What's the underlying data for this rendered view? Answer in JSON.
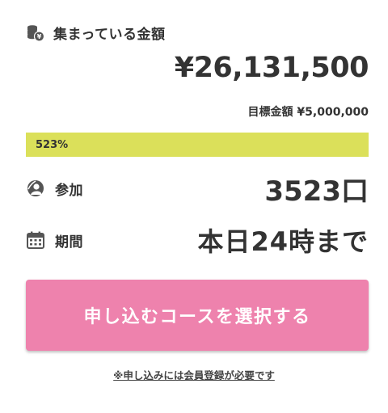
{
  "raised": {
    "label": "集まっている金額",
    "amount": "¥26,131,500",
    "goal_text": "目標金額 ¥5,000,000",
    "icon": "coin-stack-icon"
  },
  "progress": {
    "percent_label": "523%",
    "fill_fraction": 1.0,
    "fill_color": "#dbe05a"
  },
  "participants": {
    "label": "参加",
    "value": "3523口",
    "icon": "person-circle-icon"
  },
  "period": {
    "label": "期間",
    "value": "本日24時まで",
    "icon": "calendar-icon"
  },
  "cta": {
    "label": "申し込むコースを選択する",
    "color": "#ee82ad"
  },
  "note": {
    "text": "※申し込みには会員登録が必要です"
  }
}
